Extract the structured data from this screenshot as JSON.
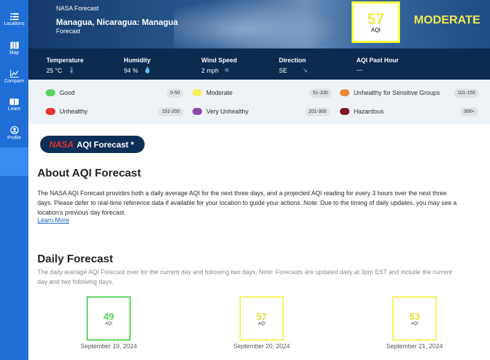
{
  "sidebar": {
    "items": [
      {
        "label": "Locations",
        "icon": "list-icon"
      },
      {
        "label": "Map",
        "icon": "map-icon"
      },
      {
        "label": "Compare",
        "icon": "chart-line-icon"
      },
      {
        "label": "Learn",
        "icon": "book-icon"
      },
      {
        "label": "Profile",
        "icon": "user-circle-icon"
      }
    ]
  },
  "header": {
    "brand": "NASA Forecast",
    "location": "Managua, Nicaragua: Managua",
    "subtitle": "Forecast",
    "aqi_value": "57",
    "aqi_unit": "AQI",
    "aqi_category": "MODERATE"
  },
  "stats": [
    {
      "title": "Temperature",
      "value": "25 °C",
      "icon": "thermometer-icon"
    },
    {
      "title": "Humidity",
      "value": "94 %",
      "icon": "droplet-icon"
    },
    {
      "title": "Wind Speed",
      "value": "2 mph",
      "icon": "wind-icon"
    },
    {
      "title": "Direction",
      "value": "SE",
      "icon": "arrow-down-right-icon"
    },
    {
      "title": "AQI Past Hour",
      "value": "---"
    }
  ],
  "legend": [
    {
      "label": "Good",
      "range": "0-50",
      "color": "#5bd45b"
    },
    {
      "label": "Moderate",
      "range": "51-100",
      "color": "#f5f25a"
    },
    {
      "label": "Unhealthy for Sensitive Groups",
      "range": "101-150",
      "color": "#f08a3a"
    },
    {
      "label": "Unhealthy",
      "range": "151-200",
      "color": "#e8322e"
    },
    {
      "label": "Very Unhealthy",
      "range": "201-300",
      "color": "#8e4aa8"
    },
    {
      "label": "Hazardous",
      "range": "300+",
      "color": "#7a1626"
    }
  ],
  "badge": {
    "logo": "NASA",
    "text": "AQI Forecast *"
  },
  "about": {
    "title": "About AQI Forecast",
    "lines": [
      "The NASA AQI Forecast provides both a daily average AQI for the next three days, and a projected AQI reading for every 3 hours over the next three",
      "days. Please defer to real-time reference data if available for your location to guide your actions. Note: Due to the timing of daily updates, you may see a",
      "location's previous day forecast."
    ],
    "learn_more": "Learn More"
  },
  "daily": {
    "title": "Daily Forecast",
    "lines": [
      "The daily average AQI Forecast over for the current day and following two days. Note: Forecasts are updated daily at 3pm EST and include the current",
      "day and two following days."
    ],
    "unit": "AQI",
    "days": [
      {
        "value": "49",
        "date": "September 19, 2024",
        "color": "#5bd45b"
      },
      {
        "value": "57",
        "date": "September 20, 2024",
        "color": "#f5f25a"
      },
      {
        "value": "53",
        "date": "September 21, 2024",
        "color": "#f5f25a"
      }
    ]
  }
}
